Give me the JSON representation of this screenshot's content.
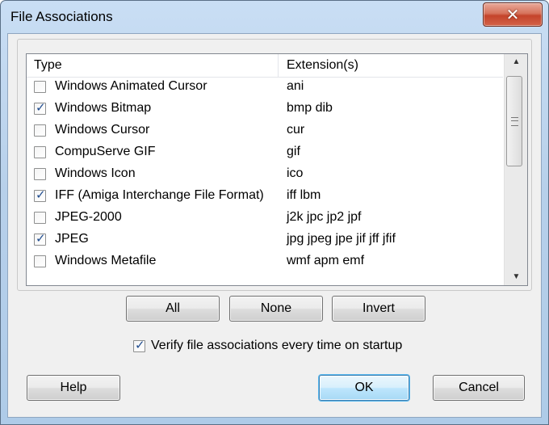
{
  "window": {
    "title": "File Associations",
    "close_glyph": "✕"
  },
  "list": {
    "headers": {
      "type": "Type",
      "extensions": "Extension(s)"
    },
    "rows": [
      {
        "name": "Windows Animated Cursor",
        "ext": "ani",
        "checked": false
      },
      {
        "name": "Windows Bitmap",
        "ext": "bmp dib",
        "checked": true
      },
      {
        "name": "Windows Cursor",
        "ext": "cur",
        "checked": false
      },
      {
        "name": "CompuServe GIF",
        "ext": "gif",
        "checked": false
      },
      {
        "name": "Windows Icon",
        "ext": "ico",
        "checked": false
      },
      {
        "name": "IFF (Amiga Interchange File Format)",
        "ext": "iff lbm",
        "checked": true
      },
      {
        "name": "JPEG-2000",
        "ext": "j2k jpc jp2 jpf",
        "checked": false
      },
      {
        "name": "JPEG",
        "ext": "jpg jpeg jpe jif jff jfif",
        "checked": true
      },
      {
        "name": "Windows Metafile",
        "ext": "wmf apm emf",
        "checked": false
      }
    ]
  },
  "selection_buttons": {
    "all": "All",
    "none": "None",
    "invert": "Invert"
  },
  "verify": {
    "label": "Verify file associations every time on startup",
    "checked": true
  },
  "footer": {
    "help": "Help",
    "ok": "OK",
    "cancel": "Cancel"
  },
  "glyphs": {
    "check": "✓",
    "scroll_up": "▲",
    "scroll_down": "▼"
  },
  "icons": {
    "close": "close-icon",
    "scroll_up": "chevron-up-icon",
    "scroll_down": "chevron-down-icon"
  }
}
